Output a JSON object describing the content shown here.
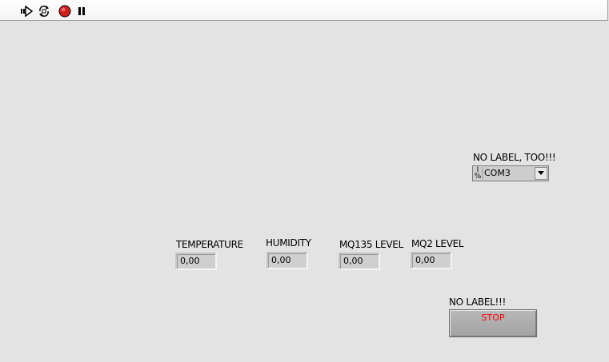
{
  "toolbar": {
    "buttons": [
      {
        "icon": "run-arrow-icon"
      },
      {
        "icon": "run-continuously-icon"
      },
      {
        "icon": "abort-execution-icon"
      },
      {
        "icon": "pause-icon"
      }
    ]
  },
  "indicators": [
    {
      "label": "TEMPERATURE",
      "value": "0,00"
    },
    {
      "label": "HUMIDITY",
      "value": "0,00"
    },
    {
      "label": "MQ135 LEVEL",
      "value": "0,00"
    },
    {
      "label": "MQ2 LEVEL",
      "value": "0,00"
    }
  ],
  "visa": {
    "label": "NO LABEL, TOO!!!",
    "value": "COM3",
    "icon": "visa-resource-icon"
  },
  "stop": {
    "label": "NO LABEL!!!",
    "button_text": "STOP",
    "text_color": "#ff0000"
  },
  "colors": {
    "panel_background": "#e3e3e3",
    "indicator_background": "#cfcfcf"
  }
}
